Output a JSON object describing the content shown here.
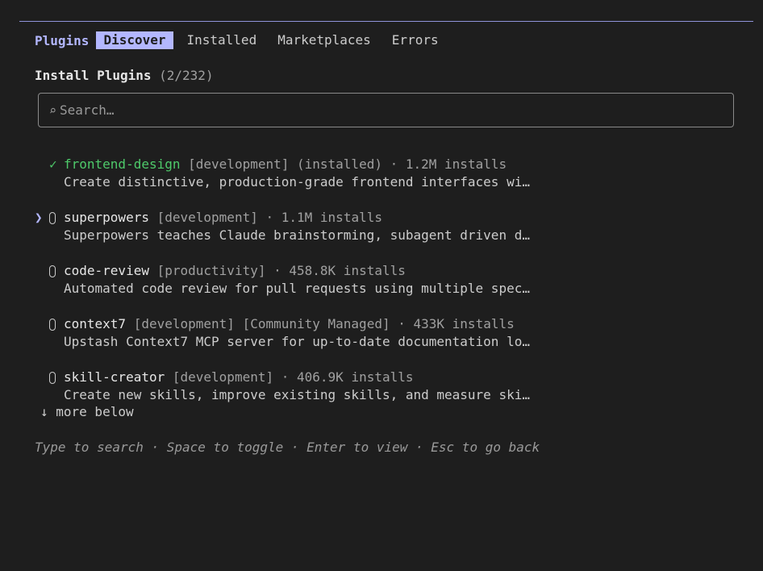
{
  "tabs": {
    "section_label": "Plugins",
    "items": [
      "Discover",
      "Installed",
      "Marketplaces",
      "Errors"
    ],
    "active": "Discover"
  },
  "heading": {
    "title": "Install Plugins",
    "count": "(2/232)"
  },
  "search": {
    "icon": "⌕",
    "placeholder": "Search…",
    "value": ""
  },
  "plugins": [
    {
      "name": "frontend-design",
      "tags": "[development] (installed)",
      "installs": "· 1.2M installs",
      "description": "Create distinctive, production-grade frontend interfaces wi…",
      "installed": true,
      "selected": false
    },
    {
      "name": "superpowers",
      "tags": "[development]",
      "installs": "· 1.1M installs",
      "description": "Superpowers teaches Claude brainstorming, subagent driven d…",
      "installed": false,
      "selected": true
    },
    {
      "name": "code-review",
      "tags": "[productivity]",
      "installs": "· 458.8K installs",
      "description": "Automated code review for pull requests using multiple spec…",
      "installed": false,
      "selected": false
    },
    {
      "name": "context7",
      "tags": "[development] [Community Managed]",
      "installs": "· 433K installs",
      "description": "Upstash Context7 MCP server for up-to-date documentation lo…",
      "installed": false,
      "selected": false
    },
    {
      "name": "skill-creator",
      "tags": "[development]",
      "installs": "· 406.9K installs",
      "description": "Create new skills, improve existing skills, and measure ski…",
      "installed": false,
      "selected": false
    }
  ],
  "more_below": "↓ more below",
  "hint": "Type to search · Space to toggle · Enter to view · Esc to go back",
  "icons": {
    "check": "✓",
    "cursor": "❯"
  },
  "colors": {
    "background": "#1e1e1e",
    "accent": "#b3b7ff",
    "installed": "#4ec96a",
    "text": "#cccccc",
    "dim": "#a0a0a0"
  }
}
